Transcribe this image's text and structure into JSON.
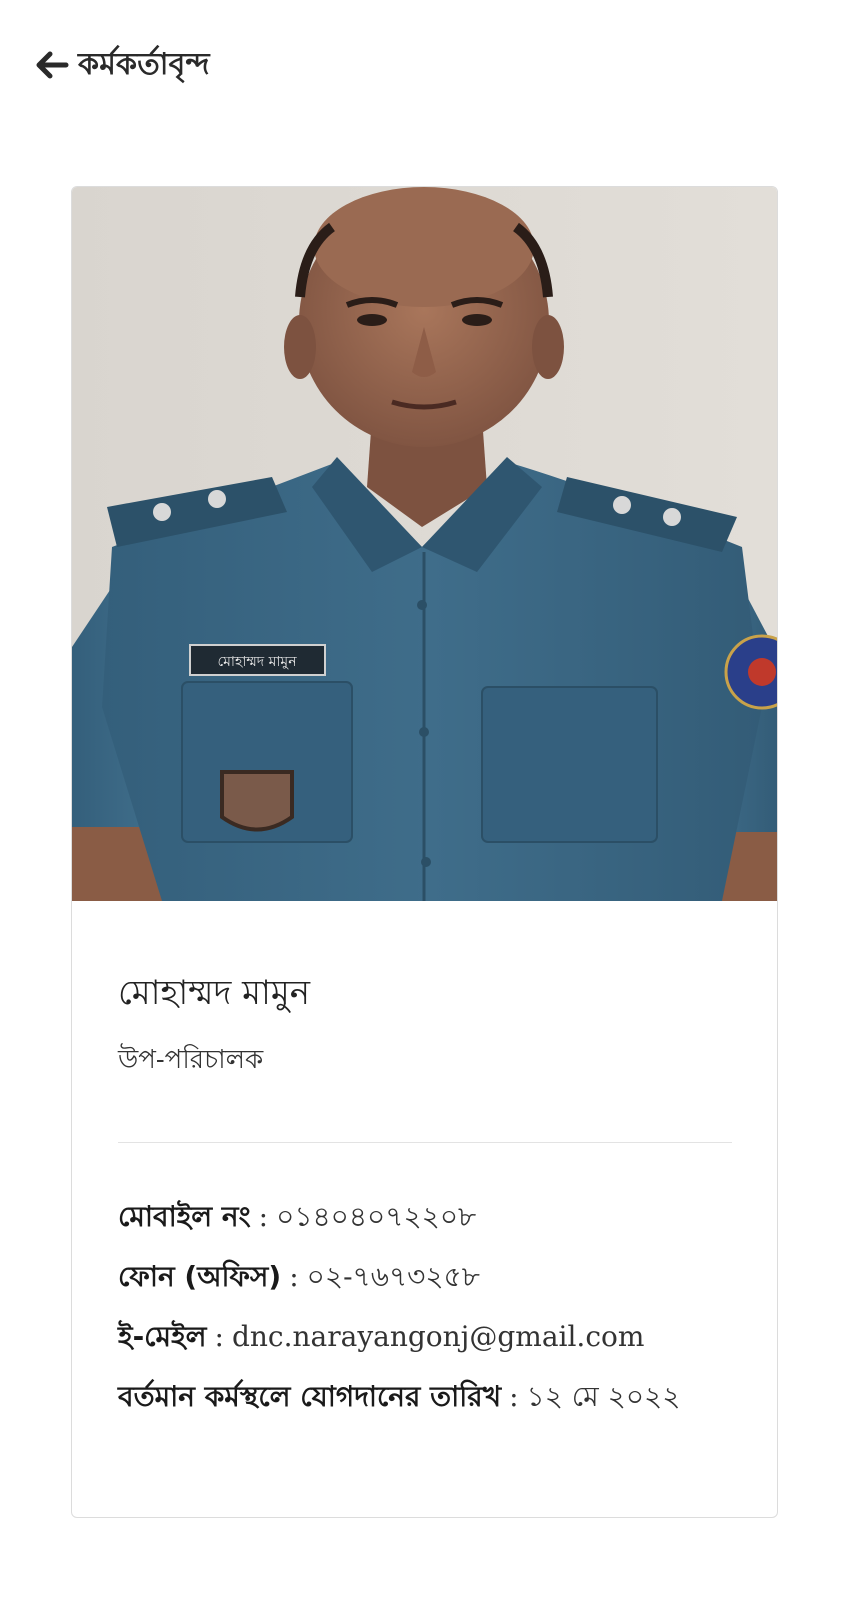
{
  "header": {
    "title": "কর্মকর্তাবৃন্দ"
  },
  "profile": {
    "name": "মোহাম্মদ মামুন",
    "designation": "উপ-পরিচালক",
    "name_tag": "মোহাম্মদ মামুন",
    "details": {
      "mobile_label": "মোবাইল নং",
      "mobile_value": "০১৪০৪০৭২২০৮",
      "phone_label": "ফোন (অফিস)",
      "phone_value": "০২-৭৬৭৩২৫৮",
      "email_label": "ই-মেইল",
      "email_value": "dnc.narayangonj@gmail.com",
      "joining_label": "বর্তমান কর্মস্থলে যোগদানের তারিখ",
      "joining_value": "১২ মে ২০২২",
      "separator": ":"
    }
  },
  "colors": {
    "uniform": "#3d6a86",
    "wall": "#dcd8d2",
    "card_border": "#dcdcdc",
    "text_dark": "#222222"
  }
}
